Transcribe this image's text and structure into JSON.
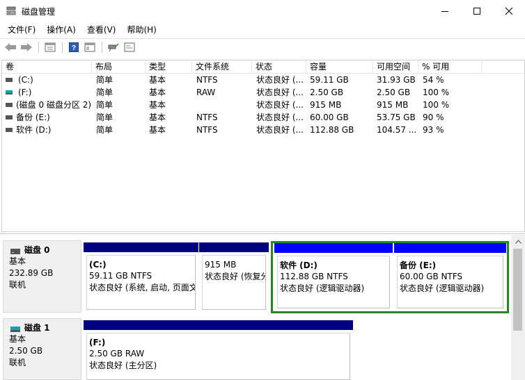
{
  "window": {
    "title": "磁盘管理"
  },
  "menu": [
    "文件(F)",
    "操作(A)",
    "查看(V)",
    "帮助(H)"
  ],
  "toolbar": {
    "icons": [
      "back-arrow-icon",
      "forward-arrow-icon",
      "properties-icon",
      "help-icon",
      "view-icon",
      "connect-icon",
      "console-icon"
    ]
  },
  "list": {
    "columns": [
      "卷",
      "布局",
      "类型",
      "文件系统",
      "状态",
      "容量",
      "可用空间",
      "% 可用"
    ],
    "rows": [
      {
        "volume": "(C:)",
        "layout": "简单",
        "type": "基本",
        "fs": "NTFS",
        "status": "状态良好 (...",
        "capacity": "59.11 GB",
        "free": "31.93 GB",
        "pct": "54 %",
        "icon_color": "#555555"
      },
      {
        "volume": "(F:)",
        "layout": "简单",
        "type": "基本",
        "fs": "RAW",
        "status": "状态良好 (...",
        "capacity": "2.50 GB",
        "free": "2.50 GB",
        "pct": "100 %",
        "icon_color": "#1a9fb0"
      },
      {
        "volume": "(磁盘 0 磁盘分区 2)",
        "layout": "简单",
        "type": "基本",
        "fs": "",
        "status": "状态良好 (...",
        "capacity": "915 MB",
        "free": "915 MB",
        "pct": "100 %",
        "icon_color": "#555555"
      },
      {
        "volume": "备份 (E:)",
        "layout": "简单",
        "type": "基本",
        "fs": "NTFS",
        "status": "状态良好 (...",
        "capacity": "60.00 GB",
        "free": "53.75 GB",
        "pct": "90 %",
        "icon_color": "#555555"
      },
      {
        "volume": "软件 (D:)",
        "layout": "简单",
        "type": "基本",
        "fs": "NTFS",
        "status": "状态良好 (...",
        "capacity": "112.88 GB",
        "free": "104.57 ...",
        "pct": "93 %",
        "icon_color": "#555555"
      }
    ]
  },
  "disks": [
    {
      "name": "磁盘 0",
      "kind": "基本",
      "size": "232.89 GB",
      "state": "联机",
      "partitions": [
        {
          "name": "(C:)",
          "size": "59.11 GB NTFS",
          "status": "状态良好 (系统, 启动, 页面文"
        },
        {
          "name": "",
          "size": "915 MB",
          "status": "状态良好 (恢复分"
        },
        {
          "name": "软件  (D:)",
          "size": "112.88 GB NTFS",
          "status": "状态良好 (逻辑驱动器)"
        },
        {
          "name": "备份  (E:)",
          "size": "60.00 GB NTFS",
          "status": "状态良好 (逻辑驱动器)"
        }
      ]
    },
    {
      "name": "磁盘 1",
      "kind": "基本",
      "size": "2.50 GB",
      "state": "联机",
      "partitions": [
        {
          "name": "(F:)",
          "size": "2.50 GB RAW",
          "status": "状态良好 (主分区)"
        }
      ]
    }
  ],
  "colors": {
    "primary_bar": "#000080",
    "logical_bar": "#0000ff",
    "extended_frame": "#228b22"
  }
}
